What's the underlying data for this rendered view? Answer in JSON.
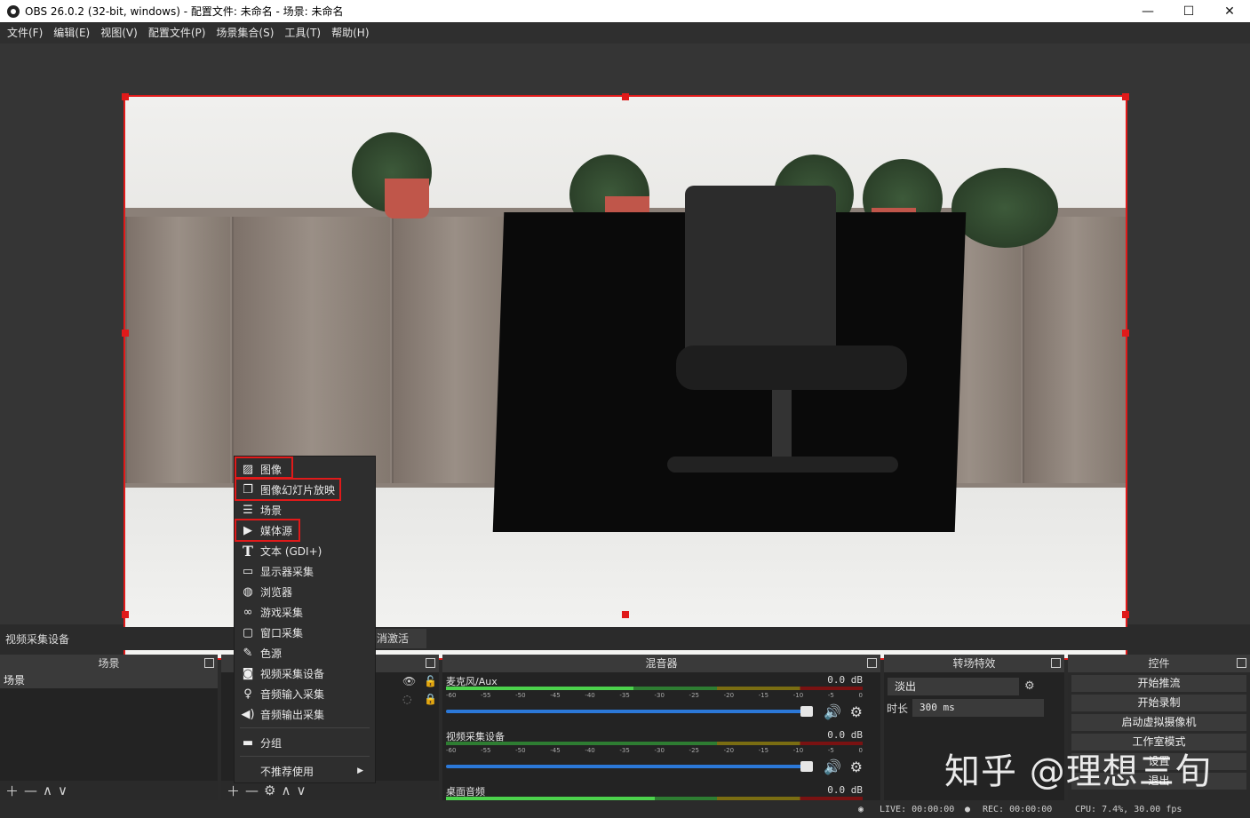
{
  "window": {
    "title": "OBS 26.0.2 (32-bit, windows) - 配置文件: 未命名 - 场景: 未命名",
    "controls": [
      "—",
      "☐",
      "✕"
    ]
  },
  "menubar": [
    "文件(F)",
    "编辑(E)",
    "视图(V)",
    "配置文件(P)",
    "场景集合(S)",
    "工具(T)",
    "帮助(H)"
  ],
  "source_bar": {
    "selected_source": "视频采集设备",
    "deactivate_label": "消激活"
  },
  "docks": {
    "scenes": {
      "title": "场景",
      "items": [
        "场景"
      ]
    },
    "mixer": {
      "title": "混音器",
      "channels": [
        {
          "name": "麦克风/Aux",
          "db": "0.0 dB",
          "level": 0.45
        },
        {
          "name": "视频采集设备",
          "db": "0.0 dB",
          "level": 0.0
        },
        {
          "name": "桌面音频",
          "db": "0.0 dB",
          "level": 0.5
        }
      ],
      "ticks": [
        "-60",
        "-55",
        "-50",
        "-45",
        "-40",
        "-35",
        "-30",
        "-25",
        "-20",
        "-15",
        "-10",
        "-5",
        "0"
      ]
    },
    "transitions": {
      "title": "转场特效",
      "selected": "淡出",
      "duration_label": "时长",
      "duration_value": "300 ms"
    },
    "controls": {
      "title": "控件",
      "buttons": [
        "开始推流",
        "开始录制",
        "启动虚拟摄像机",
        "工作室模式",
        "设置",
        "退出"
      ]
    }
  },
  "context_menu": {
    "items": [
      {
        "label": "图像",
        "icon": "image-icon"
      },
      {
        "label": "图像幻灯片放映",
        "icon": "slideshow-icon"
      },
      {
        "label": "场景",
        "icon": "list-icon"
      },
      {
        "label": "媒体源",
        "icon": "play-icon"
      },
      {
        "label": "文本 (GDI+)",
        "icon": "text-icon"
      },
      {
        "label": "显示器采集",
        "icon": "monitor-icon"
      },
      {
        "label": "浏览器",
        "icon": "globe-icon"
      },
      {
        "label": "游戏采集",
        "icon": "gamepad-icon"
      },
      {
        "label": "窗口采集",
        "icon": "window-icon"
      },
      {
        "label": "色源",
        "icon": "brush-icon"
      },
      {
        "label": "视频采集设备",
        "icon": "camera-icon"
      },
      {
        "label": "音频输入采集",
        "icon": "microphone-icon"
      },
      {
        "label": "音频输出采集",
        "icon": "speaker-icon"
      },
      {
        "label": "分组",
        "icon": "folder-icon"
      },
      {
        "label": "不推荐使用",
        "icon": "chevron-right-icon"
      }
    ]
  },
  "status": {
    "live": "LIVE: 00:00:00",
    "rec": "REC: 00:00:00",
    "cpu": "CPU: 7.4%, 30.00 fps"
  },
  "watermark": "知乎 @理想三旬",
  "colors": {
    "selection": "#e01a1a",
    "volume": "#2b78d8"
  }
}
